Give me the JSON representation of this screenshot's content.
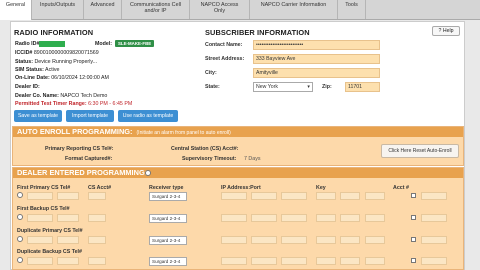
{
  "tabs": [
    {
      "label": "General"
    },
    {
      "label": "Inputs/Outputs"
    },
    {
      "label": "Advanced"
    },
    {
      "label": "Communications Cell and/or IP"
    },
    {
      "label": "NAPCO Access Only"
    },
    {
      "label": "NAPCO Carrier Information"
    },
    {
      "label": "Tools"
    }
  ],
  "help_label": "Help",
  "radio": {
    "title": "RADIO INFORMATION",
    "radio_id_label": "Radio ID#",
    "model_label": "Model:",
    "model_value": "SLE-MAKE-FBE",
    "iccid_label": "ICCID#",
    "iccid_value": "8900100000009820071569",
    "status_label": "Status:",
    "status_value": "Device Running Properly...",
    "sim_label": "SIM Status:",
    "sim_value": "Active",
    "online_label": "On-Line Date:",
    "online_value": "06/10/2024 12:00:00 AM",
    "dealer_id_label": "Dealer ID:",
    "dealer_co_label": "Dealer Co. Name:",
    "dealer_co_value": "NAPCO Tech Demo",
    "timer_label": "Permitted Test Timer Range:",
    "timer_value": "6:30 PM - 6:45 PM"
  },
  "buttons": {
    "save_template": "Save as template",
    "import_template": "Import template",
    "use_radio": "Use radio as template"
  },
  "subscriber": {
    "title": "SUBSCRIBER INFORMATION",
    "contact_label": "Contact Name:",
    "contact_value": "••••••••••••••••••••••••••",
    "street_label": "Street Address:",
    "street_value": "333 Bayview Ave",
    "city_label": "City:",
    "city_value": "Amityville",
    "state_label": "State:",
    "state_value": "New York",
    "zip_label": "Zip:",
    "zip_value": "11701"
  },
  "auto_enroll": {
    "title": "AUTO ENROLL PROGRAMMING:",
    "note": "(Initiate an alarm from panel to auto enroll)",
    "primary_label": "Primary Reporting CS Tel#:",
    "format_label": "Format Captured#:",
    "central_label": "Central Station (CS) Acct#:",
    "timeout_label": "Supervisory Timeout:",
    "timeout_value": "7 Days",
    "reset_button": "Click Here Reset Auto-Enroll"
  },
  "dealer": {
    "title": "DEALER ENTERED PROGRAMMING:",
    "columns": [
      "CS Acct#",
      "Receiver type",
      "IP Address:Port",
      "Key",
      "Acct #"
    ],
    "rows": [
      {
        "label": "First Primary CS Tel#",
        "receiver": "Surgard 2-3-4"
      },
      {
        "label": "First Backup CS Tel#",
        "receiver": "Surgard 2-3-4"
      },
      {
        "label": "Duplicate Primary CS Tel#",
        "receiver": "Surgard 2-3-4"
      },
      {
        "label": "Duplicate Backup CS Tel#",
        "receiver": "Surgard 2-3-4"
      }
    ]
  }
}
